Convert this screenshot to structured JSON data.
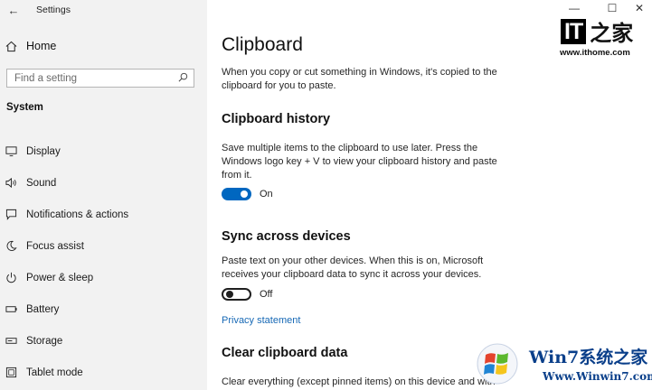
{
  "window": {
    "title": "Settings",
    "back_icon": "back-arrow-icon",
    "minimize_glyph": "—",
    "maximize_glyph": "☐",
    "close_glyph": "✕"
  },
  "sidebar": {
    "home_label": "Home",
    "search_placeholder": "Find a setting",
    "section_label": "System",
    "items": [
      {
        "label": "Display",
        "icon": "display-icon"
      },
      {
        "label": "Sound",
        "icon": "speaker-icon"
      },
      {
        "label": "Notifications & actions",
        "icon": "notification-icon"
      },
      {
        "label": "Focus assist",
        "icon": "moon-icon"
      },
      {
        "label": "Power & sleep",
        "icon": "power-icon"
      },
      {
        "label": "Battery",
        "icon": "battery-icon"
      },
      {
        "label": "Storage",
        "icon": "storage-icon"
      },
      {
        "label": "Tablet mode",
        "icon": "tablet-icon"
      }
    ]
  },
  "main": {
    "title": "Clipboard",
    "intro": "When you copy or cut something in Windows, it's copied to the clipboard for you to paste.",
    "history": {
      "heading": "Clipboard history",
      "description": "Save multiple items to the clipboard to use later. Press the Windows logo key + V to view your clipboard history and paste from it.",
      "toggle_state": true,
      "toggle_label": "On"
    },
    "sync": {
      "heading": "Sync across devices",
      "description": "Paste text on your other devices. When this is on, Microsoft receives your clipboard data to sync it across your devices.",
      "toggle_state": false,
      "toggle_label": "Off",
      "privacy_link": "Privacy statement"
    },
    "clear": {
      "heading": "Clear clipboard data",
      "description": "Clear everything (except pinned items) on this device and with"
    }
  },
  "watermarks": {
    "ithome_logo_text": "IT",
    "ithome_logo_char": "之家",
    "ithome_url": "www.ithome.com",
    "win7_brand": "Win7系统之家",
    "win7_url": "Www.Winwin7.com"
  },
  "colors": {
    "accent": "#0067c0",
    "link": "#1668b5",
    "sidebar_bg": "#f2f2f2"
  }
}
